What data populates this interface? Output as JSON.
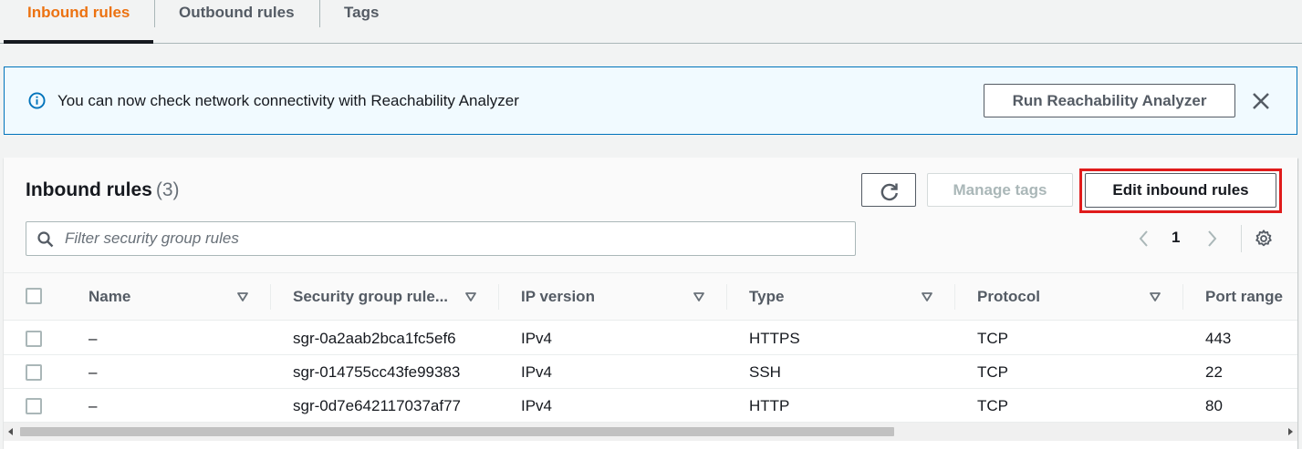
{
  "tabs": [
    {
      "label": "Inbound rules",
      "active": true
    },
    {
      "label": "Outbound rules",
      "active": false
    },
    {
      "label": "Tags",
      "active": false
    }
  ],
  "flash": {
    "icon": "info-icon",
    "message": "You can now check network connectivity with Reachability Analyzer",
    "button_label": "Run Reachability Analyzer",
    "close_icon": "close-icon"
  },
  "panel": {
    "title": "Inbound rules",
    "count": "(3)",
    "refresh_icon": "refresh-icon",
    "manage_tags_label": "Manage tags",
    "edit_label": "Edit inbound rules",
    "search_placeholder": "Filter security group rules",
    "search_value": "",
    "page": "1",
    "settings_icon": "gear-icon"
  },
  "table": {
    "columns": [
      "Name",
      "Security group rule...",
      "IP version",
      "Type",
      "Protocol",
      "Port range"
    ],
    "rows": [
      {
        "name": "–",
        "rule_id": "sgr-0a2aab2bca1fc5ef6",
        "ip_version": "IPv4",
        "type": "HTTPS",
        "protocol": "TCP",
        "port_range": "443"
      },
      {
        "name": "–",
        "rule_id": "sgr-014755cc43fe99383",
        "ip_version": "IPv4",
        "type": "SSH",
        "protocol": "TCP",
        "port_range": "22"
      },
      {
        "name": "–",
        "rule_id": "sgr-0d7e642117037af77",
        "ip_version": "IPv4",
        "type": "HTTP",
        "protocol": "TCP",
        "port_range": "80"
      }
    ]
  },
  "colors": {
    "accent": "#ec7211",
    "info_border": "#0073bb",
    "info_bg": "#f1faff",
    "highlight": "#e01b1b"
  }
}
